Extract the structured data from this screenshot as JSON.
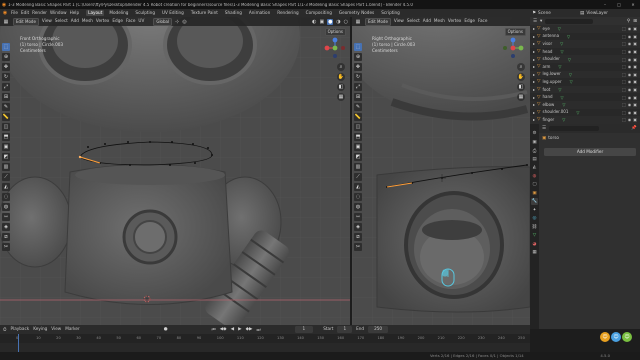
{
  "window": {
    "title": "1-3 Modeling Basic Shapes Part 1 [C:\\Users\\fty\\Py\\Desktop\\Blender 4.5 Robot creation for beginners\\source files\\1-3 Modeling Basic Shapes Part 1\\1-3 Modeling Basic Shapes Part 1.blend] - Blender 4.5.0"
  },
  "menu": {
    "items": [
      "File",
      "Edit",
      "Render",
      "Window",
      "Help"
    ],
    "workspaces": [
      "Layout",
      "Modeling",
      "Sculpting",
      "UV Editing",
      "Texture Paint",
      "Shading",
      "Animation",
      "Rendering",
      "Compositing",
      "Geometry Nodes",
      "Scripting"
    ],
    "active_workspace": "Layout"
  },
  "scene": {
    "scene_label": "Scene",
    "view_layer_label": "ViewLayer"
  },
  "viewport_left": {
    "mode": "Edit Mode",
    "menus": [
      "View",
      "Select",
      "Add",
      "Mesh",
      "Vertex",
      "Edge",
      "Face",
      "UV"
    ],
    "transform": "Global",
    "view_name": "Front Orthographic",
    "info": "(1) torso | Circle.003",
    "units": "Centimeters",
    "options": "Options"
  },
  "viewport_right": {
    "mode": "Edit Mode",
    "menus": [
      "View",
      "Select",
      "Add",
      "Mesh",
      "Vertex",
      "Edge",
      "Face"
    ],
    "view_name": "Right Orthographic",
    "info": "(1) torso | Circle.003",
    "units": "Centimeters",
    "options": "Options"
  },
  "outliner": {
    "rows": [
      {
        "name": "eye",
        "active": false
      },
      {
        "name": "antenna",
        "active": false
      },
      {
        "name": "visor",
        "active": false
      },
      {
        "name": "head",
        "active": false
      },
      {
        "name": "shoulder",
        "active": false
      },
      {
        "name": "arm",
        "active": false
      },
      {
        "name": "leg.lower",
        "active": false
      },
      {
        "name": "leg.upper",
        "active": false
      },
      {
        "name": "foot",
        "active": false
      },
      {
        "name": "hand",
        "active": false
      },
      {
        "name": "elbow",
        "active": false
      },
      {
        "name": "shoulder.001",
        "active": false
      },
      {
        "name": "finger",
        "active": false
      },
      {
        "name": "torso",
        "active": true
      }
    ]
  },
  "properties": {
    "object_name": "torso",
    "add_modifier": "Add Modifier"
  },
  "timeline": {
    "menus": [
      "Playback",
      "Keying",
      "View",
      "Marker"
    ],
    "current_frame": "1",
    "start_label": "Start",
    "start": "1",
    "end_label": "End",
    "end": "250",
    "ticks": [
      "0",
      "10",
      "20",
      "30",
      "40",
      "50",
      "60",
      "70",
      "80",
      "90",
      "100",
      "110",
      "120",
      "130",
      "140",
      "150",
      "160",
      "170",
      "180",
      "190",
      "200",
      "210",
      "220",
      "230",
      "240",
      "250"
    ]
  },
  "status": {
    "stats": "Verts 2/16 | Edges 2/16 | Faces 0/1 | Objects 1/14",
    "version": "4.5.0"
  },
  "colors": {
    "accent": "#4772b3",
    "selected_row": "#334d80",
    "mesh_highlight": "#ff9f3a",
    "axis_x": "#e0464a",
    "axis_y": "#7ab84d",
    "axis_z": "#4a7fe0"
  }
}
